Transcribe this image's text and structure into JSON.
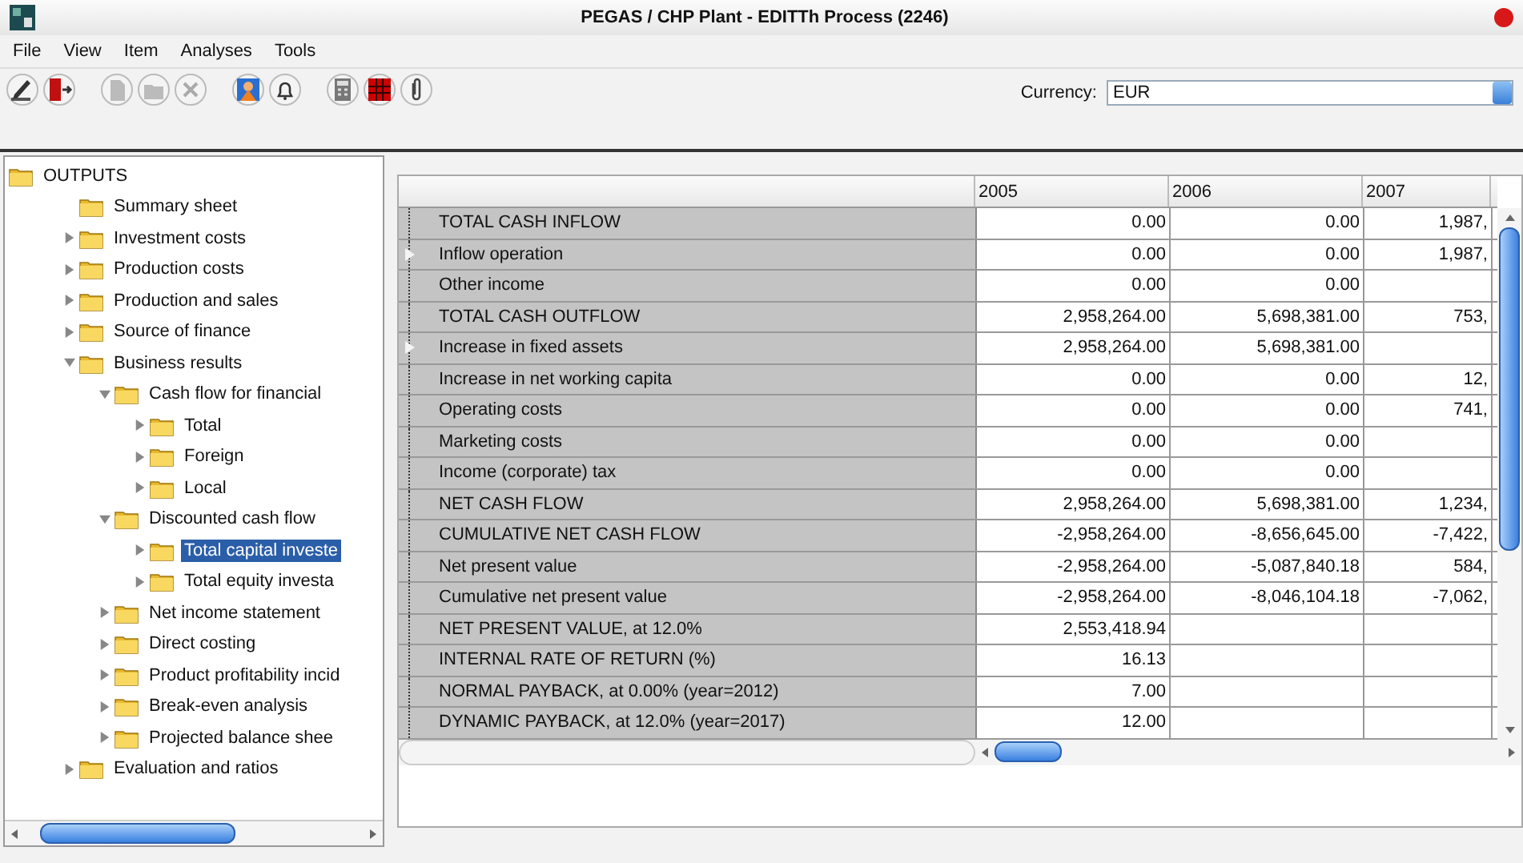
{
  "window": {
    "title": "PEGAS / CHP Plant - EDITTh Process (2246)"
  },
  "menu": [
    "File",
    "View",
    "Item",
    "Analyses",
    "Tools"
  ],
  "currency": {
    "label": "Currency:",
    "value": "EUR"
  },
  "tree": [
    {
      "label": "OUTPUTS",
      "selected": false,
      "children": [
        {
          "label": "Summary sheet",
          "selected": false
        },
        {
          "label": "Investment costs",
          "selected": false,
          "expanded": false
        },
        {
          "label": "Production costs",
          "selected": false,
          "expanded": false
        },
        {
          "label": "Production and sales",
          "selected": false,
          "expanded": false
        },
        {
          "label": "Source of finance",
          "selected": false,
          "expanded": false
        },
        {
          "label": "Business results",
          "selected": false,
          "expanded": true,
          "children": [
            {
              "label": "Cash flow for financial",
              "selected": false,
              "expanded": true,
              "children": [
                {
                  "label": "Total",
                  "selected": false,
                  "expanded": false
                },
                {
                  "label": "Foreign",
                  "selected": false,
                  "expanded": false
                },
                {
                  "label": "Local",
                  "selected": false,
                  "expanded": false
                }
              ]
            },
            {
              "label": "Discounted cash flow",
              "selected": false,
              "expanded": true,
              "children": [
                {
                  "label": "Total capital investe",
                  "selected": true,
                  "expanded": false
                },
                {
                  "label": "Total equity investa",
                  "selected": false,
                  "expanded": false
                }
              ]
            },
            {
              "label": "Net income statement",
              "selected": false,
              "expanded": false
            },
            {
              "label": "Direct costing",
              "selected": false,
              "expanded": false
            },
            {
              "label": "Product profitability incid",
              "selected": false,
              "expanded": false
            },
            {
              "label": "Break-even analysis",
              "selected": false,
              "expanded": false
            },
            {
              "label": "Projected balance shee",
              "selected": false,
              "expanded": false
            }
          ]
        },
        {
          "label": "Evaluation and ratios",
          "selected": false,
          "expanded": false
        }
      ]
    }
  ],
  "table": {
    "columns": [
      "2005",
      "2006",
      "2007"
    ],
    "rows": [
      {
        "label": "TOTAL CASH INFLOW",
        "expandable": false,
        "cells": [
          "0.00",
          "0.00",
          "1,987,"
        ]
      },
      {
        "label": "Inflow operation",
        "expandable": true,
        "cells": [
          "0.00",
          "0.00",
          "1,987,"
        ]
      },
      {
        "label": "Other income",
        "expandable": false,
        "cells": [
          "0.00",
          "0.00",
          ""
        ]
      },
      {
        "label": "TOTAL CASH OUTFLOW",
        "expandable": false,
        "cells": [
          "2,958,264.00",
          "5,698,381.00",
          "753,"
        ]
      },
      {
        "label": "Increase in fixed assets",
        "expandable": true,
        "cells": [
          "2,958,264.00",
          "5,698,381.00",
          ""
        ]
      },
      {
        "label": "Increase in net working capita",
        "expandable": false,
        "cells": [
          "0.00",
          "0.00",
          "12,"
        ]
      },
      {
        "label": "Operating costs",
        "expandable": false,
        "cells": [
          "0.00",
          "0.00",
          "741,"
        ]
      },
      {
        "label": "Marketing costs",
        "expandable": false,
        "cells": [
          "0.00",
          "0.00",
          ""
        ]
      },
      {
        "label": "Income (corporate) tax",
        "expandable": false,
        "cells": [
          "0.00",
          "0.00",
          ""
        ]
      },
      {
        "label": "NET CASH FLOW",
        "expandable": false,
        "cells": [
          "2,958,264.00",
          "5,698,381.00",
          "1,234,"
        ]
      },
      {
        "label": "CUMULATIVE NET CASH FLOW",
        "expandable": false,
        "cells": [
          "-2,958,264.00",
          "-8,656,645.00",
          "-7,422,"
        ]
      },
      {
        "label": "Net present value",
        "expandable": false,
        "cells": [
          "-2,958,264.00",
          "-5,087,840.18",
          "584,"
        ]
      },
      {
        "label": "Cumulative net present value",
        "expandable": false,
        "cells": [
          "-2,958,264.00",
          "-8,046,104.18",
          "-7,062,"
        ]
      },
      {
        "label": "NET PRESENT VALUE, at 12.0%",
        "expandable": false,
        "cells": [
          "2,553,418.94",
          "",
          ""
        ]
      },
      {
        "label": "INTERNAL RATE OF RETURN (%)",
        "expandable": false,
        "cells": [
          "16.13",
          "",
          ""
        ]
      },
      {
        "label": "NORMAL PAYBACK, at 0.00% (year=2012)",
        "expandable": false,
        "cells": [
          "7.00",
          "",
          ""
        ]
      },
      {
        "label": "DYNAMIC PAYBACK, at 12.0% (year=2017)",
        "expandable": false,
        "cells": [
          "12.00",
          "",
          ""
        ]
      }
    ]
  }
}
